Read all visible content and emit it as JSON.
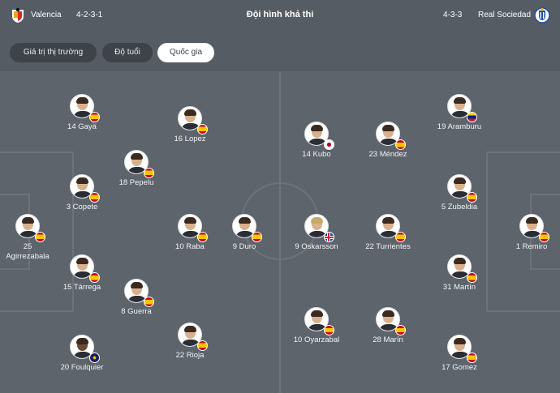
{
  "header": {
    "home_team": "Valencia",
    "home_formation": "4-2-3-1",
    "title": "Đội hình khả thi",
    "away_formation": "4-3-3",
    "away_team": "Real Sociedad"
  },
  "filters": [
    {
      "label": "Giá trị thị trường",
      "active": false
    },
    {
      "label": "Độ tuổi",
      "active": false
    },
    {
      "label": "Quốc gia",
      "active": true
    }
  ],
  "flags": {
    "spain": [
      "#c60b1e",
      "#ffc400",
      "#c60b1e"
    ],
    "japan": [
      "#ffffff",
      "#bc002d"
    ],
    "iceland": [
      "#02529c",
      "#ffffff",
      "#dc1e35"
    ],
    "venezuela": [
      "#ffcc00",
      "#00247d",
      "#cf142b"
    ],
    "france_dark": [
      "#1a1f5a",
      "#f7c600"
    ]
  },
  "players": {
    "home": [
      {
        "name": "14 Gayà",
        "flag": "spain"
      },
      {
        "name": "16 Lopez",
        "flag": "spain"
      },
      {
        "name": "18 Pepelu",
        "flag": "spain"
      },
      {
        "name": "3 Copete",
        "flag": "spain"
      },
      {
        "name": "25 Agirrezabala",
        "flag": "spain"
      },
      {
        "name": "10 Raba",
        "flag": "spain"
      },
      {
        "name": "9 Duro",
        "flag": "spain"
      },
      {
        "name": "15 Tárrega",
        "flag": "spain"
      },
      {
        "name": "8 Guerra",
        "flag": "spain"
      },
      {
        "name": "20 Foulquier",
        "flag": "france_dark"
      },
      {
        "name": "22 Rioja",
        "flag": "spain"
      }
    ],
    "away": [
      {
        "name": "19 Aramburu",
        "flag": "venezuela"
      },
      {
        "name": "14 Kubo",
        "flag": "japan"
      },
      {
        "name": "23 Méndez",
        "flag": "spain"
      },
      {
        "name": "5 Zubeldia",
        "flag": "spain"
      },
      {
        "name": "1 Remiro",
        "flag": "spain"
      },
      {
        "name": "9 Oskarsson",
        "flag": "iceland"
      },
      {
        "name": "22 Turrientes",
        "flag": "spain"
      },
      {
        "name": "31 Martín",
        "flag": "spain"
      },
      {
        "name": "10 Oyarzabal",
        "flag": "spain"
      },
      {
        "name": "28 Marín",
        "flag": "spain"
      },
      {
        "name": "17 Gomez",
        "flag": "spain"
      }
    ]
  }
}
